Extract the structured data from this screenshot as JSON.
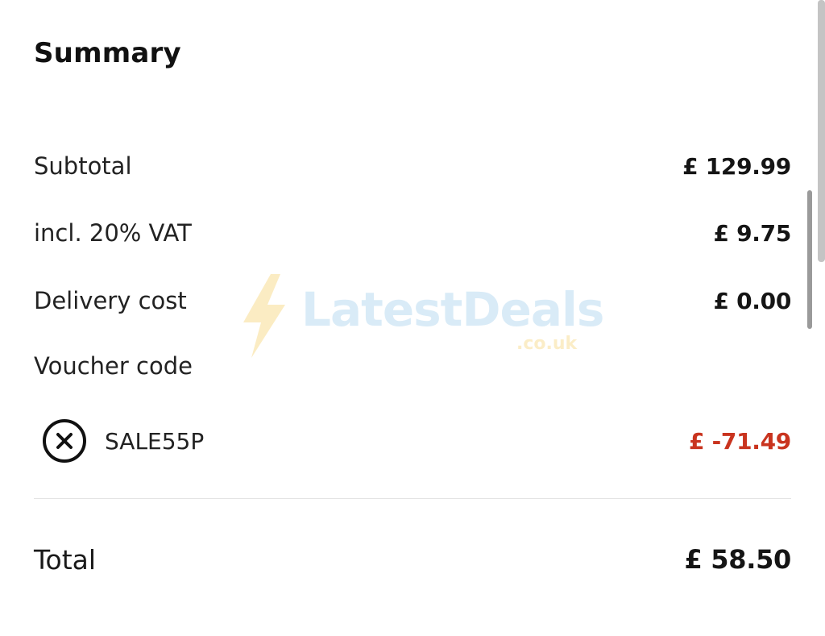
{
  "summary": {
    "title": "Summary",
    "subtotal": {
      "label": "Subtotal",
      "value": "£ 129.99"
    },
    "vat": {
      "label": "incl. 20% VAT",
      "value": "£ 9.75"
    },
    "delivery": {
      "label": "Delivery cost",
      "value": "£ 0.00"
    },
    "voucher": {
      "heading": "Voucher code",
      "code": "SALE55P",
      "discount": "£ -71.49",
      "remove_icon": "close-circle-icon",
      "discount_color": "#c9341f"
    },
    "total": {
      "label": "Total",
      "value": "£ 58.50"
    }
  },
  "watermark": {
    "text": "LatestDeals",
    "sub": ".co.uk",
    "icon": "lightning-bolt-icon"
  }
}
